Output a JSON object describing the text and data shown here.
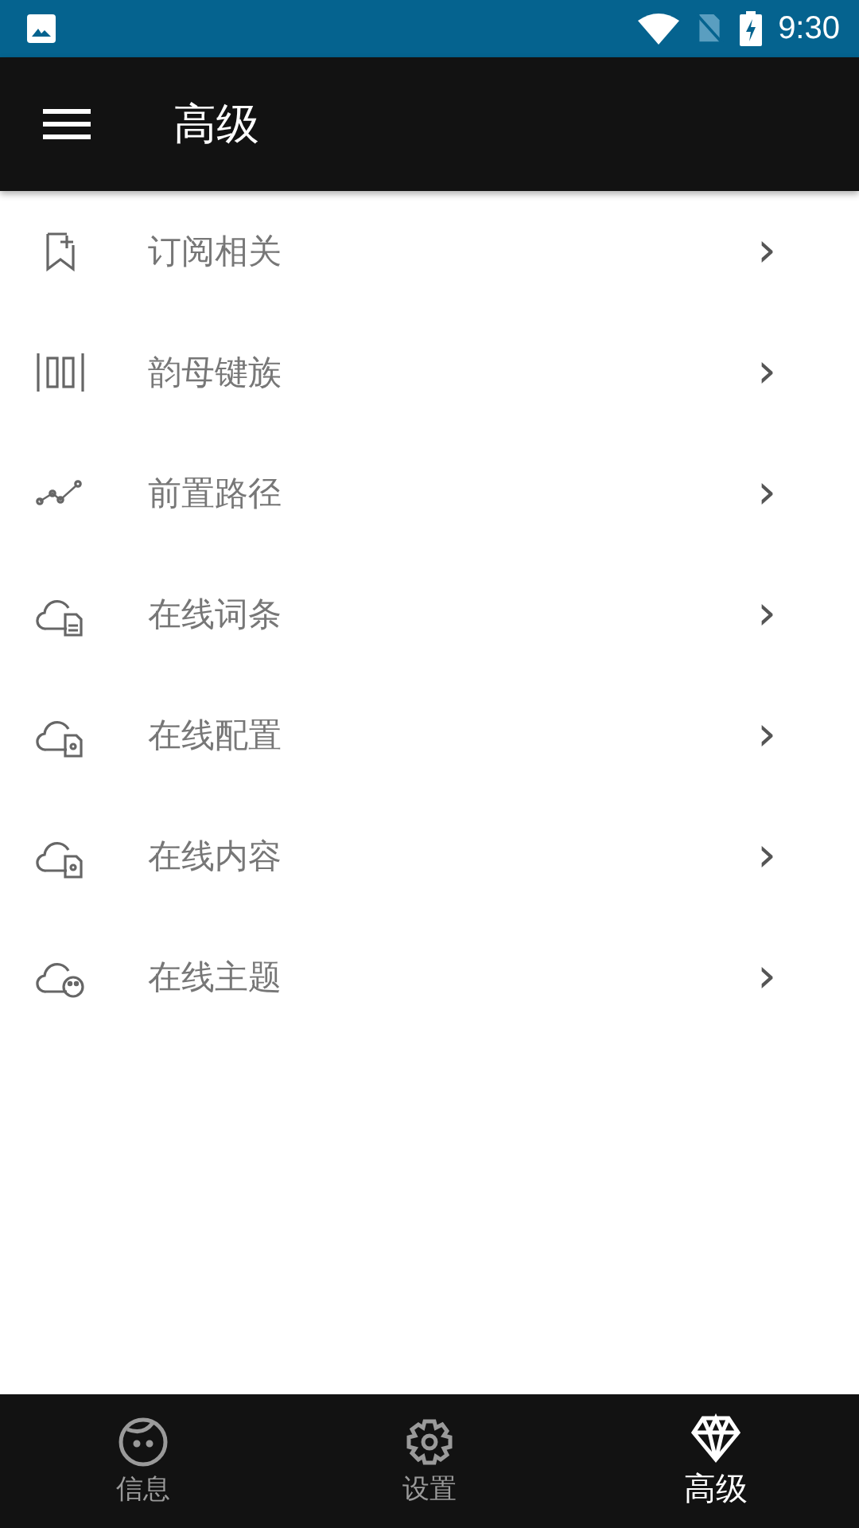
{
  "status_bar": {
    "time": "9:30"
  },
  "app_bar": {
    "title": "高级"
  },
  "items": [
    {
      "label": "订阅相关",
      "kind": "bookmark",
      "chevron": "›"
    },
    {
      "label": "韵母键族",
      "kind": "bars",
      "chevron": "›"
    },
    {
      "label": "前置路径",
      "kind": "path",
      "chevron": "›"
    },
    {
      "label": "在线词条",
      "kind": "cloud-doc",
      "chevron": "›"
    },
    {
      "label": "在线配置",
      "kind": "cloud-gear",
      "chevron": "›"
    },
    {
      "label": "在线内容",
      "kind": "cloud-gear",
      "chevron": "›"
    },
    {
      "label": "在线主题",
      "kind": "cloud-palette",
      "chevron": "›"
    }
  ],
  "bottom_nav": [
    {
      "label": "信息",
      "kind": "face",
      "selected": false
    },
    {
      "label": "设置",
      "kind": "gear",
      "selected": false
    },
    {
      "label": "高级",
      "kind": "diamond",
      "selected": true
    }
  ]
}
